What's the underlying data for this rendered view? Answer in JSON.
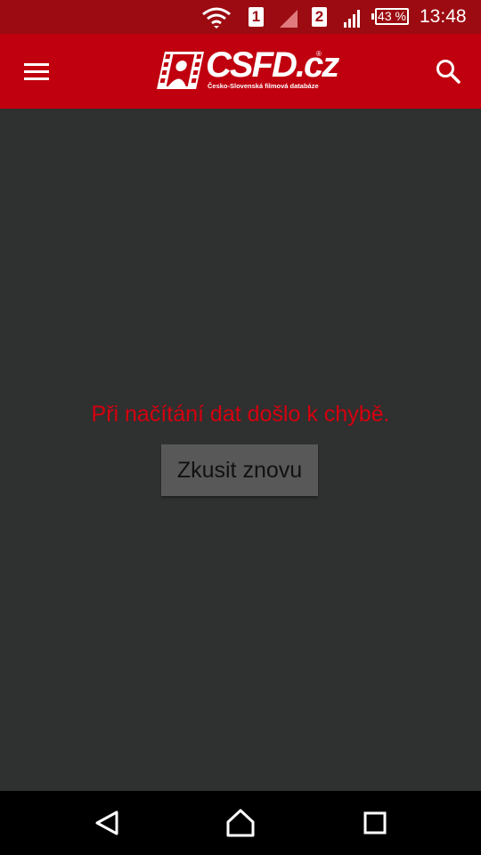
{
  "status_bar": {
    "sim1": "1",
    "sim2": "2",
    "battery": "43 %",
    "time": "13:48",
    "icons": [
      "wifi-icon",
      "signal-icon",
      "signal-icon",
      "battery-icon"
    ]
  },
  "app_bar": {
    "logo_text": "CSFD.cz",
    "logo_subtitle": "Česko-Slovenská filmová databáze",
    "logo_registered": "®",
    "menu_icon": "hamburger-menu-icon",
    "search_icon": "search-icon"
  },
  "content": {
    "error_message": "Při načítání dat došlo k chybě.",
    "retry_label": "Zkusit znovu"
  },
  "nav_bar": {
    "icons": [
      "back-icon",
      "home-icon",
      "recent-apps-icon"
    ]
  },
  "colors": {
    "status_bar": "#9b0b11",
    "app_bar": "#c0000f",
    "background": "#2f3030",
    "error_text": "#d4000f",
    "button": "#585858",
    "nav_bar": "#000000"
  }
}
